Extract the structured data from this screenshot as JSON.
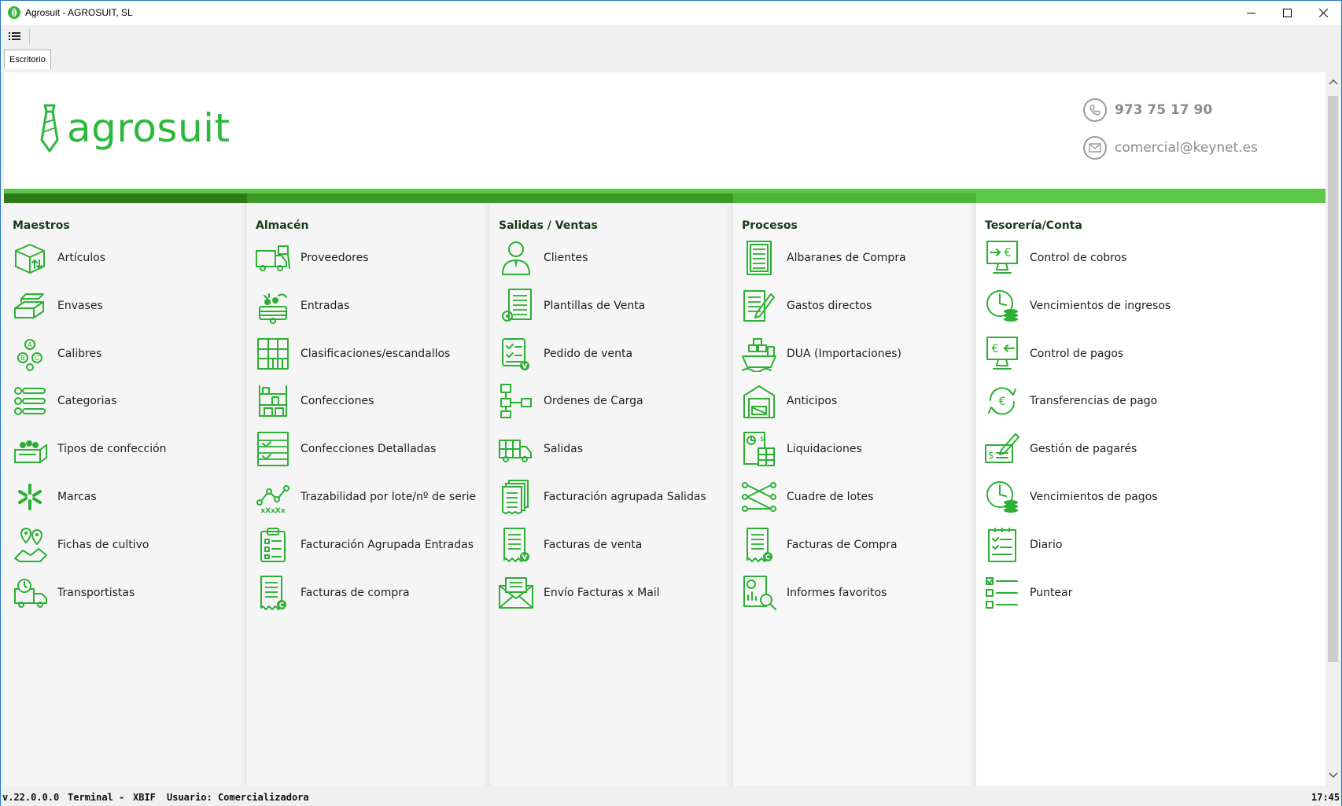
{
  "window": {
    "title": "Agrosuit - AGROSUIT, SL",
    "minimize_icon": "minimize-icon",
    "maximize_icon": "maximize-icon",
    "close_icon": "close-icon"
  },
  "toolbar": {
    "menu_icon": "list-menu-icon"
  },
  "tabs": [
    {
      "label": "Escritorio"
    }
  ],
  "header": {
    "logo_text": "agrosuit",
    "phone": "973 75 17 90",
    "email": "comercial@keynet.es"
  },
  "colors": {
    "brand_green": "#2db83d",
    "band_dark": "#2d7a18",
    "band_light": "#5cc84a",
    "icon_green": "#2bb034"
  },
  "columns": [
    {
      "title": "Maestros",
      "items": [
        {
          "label": "Artículos",
          "icon": "box-arrows-icon"
        },
        {
          "label": "Envases",
          "icon": "crates-icon"
        },
        {
          "label": "Calibres",
          "icon": "abc-circles-icon"
        },
        {
          "label": "Categorias",
          "icon": "numbered-list-icon"
        },
        {
          "label": "Tipos de confección",
          "icon": "produce-box-icon"
        },
        {
          "label": "Marcas",
          "icon": "asterisk-brand-icon"
        },
        {
          "label": "Fichas de cultivo",
          "icon": "map-pins-icon"
        },
        {
          "label": "Transportistas",
          "icon": "clock-truck-icon"
        }
      ]
    },
    {
      "title": "Almacén",
      "items": [
        {
          "label": "Proveedores",
          "icon": "delivery-truck-icon"
        },
        {
          "label": "Entradas",
          "icon": "produce-crate-icon"
        },
        {
          "label": "Clasificaciones/escandallos",
          "icon": "grid-icon"
        },
        {
          "label": "Confecciones",
          "icon": "shelves-icon"
        },
        {
          "label": "Confecciones Detalladas",
          "icon": "check-list-icon"
        },
        {
          "label": "Trazabilidad por lote/nº de serie",
          "icon": "trace-graph-icon",
          "sub": "xXxXx"
        },
        {
          "label": "Facturación Agrupada Entradas",
          "icon": "clipboard-icon"
        },
        {
          "label": "Facturas de compra",
          "icon": "invoice-c-icon",
          "badge": "C"
        }
      ]
    },
    {
      "title": "Salidas / Ventas",
      "items": [
        {
          "label": "Clientes",
          "icon": "client-person-icon"
        },
        {
          "label": "Plantillas de Venta",
          "icon": "document-gear-icon"
        },
        {
          "label": "Pedido de venta",
          "icon": "order-checklist-icon",
          "badge": "V"
        },
        {
          "label": "Ordenes de Carga",
          "icon": "flowchart-icon"
        },
        {
          "label": "Salidas",
          "icon": "truck-icon"
        },
        {
          "label": "Facturación agrupada Salidas",
          "icon": "stacked-documents-icon"
        },
        {
          "label": "Facturas de venta",
          "icon": "invoice-v-icon",
          "badge": "V"
        },
        {
          "label": "Envío Facturas x Mail",
          "icon": "envelope-icon"
        }
      ]
    },
    {
      "title": "Procesos",
      "items": [
        {
          "label": "Albaranes de Compra",
          "icon": "ledger-icon"
        },
        {
          "label": "Gastos directos",
          "icon": "document-pen-icon"
        },
        {
          "label": "DUA (Importaciones)",
          "icon": "cargo-ship-icon"
        },
        {
          "label": "Anticipos",
          "icon": "warehouse-money-icon"
        },
        {
          "label": "Liquidaciones",
          "icon": "calculator-document-icon"
        },
        {
          "label": "Cuadre de lotes",
          "icon": "lot-matching-icon"
        },
        {
          "label": "Facturas de Compra",
          "icon": "invoice-c-icon",
          "badge": "C"
        },
        {
          "label": "Informes favoritos",
          "icon": "report-magnifier-icon"
        }
      ]
    },
    {
      "title": "Tesorería/Conta",
      "items": [
        {
          "label": "Control de cobros",
          "icon": "monitor-euro-in-icon"
        },
        {
          "label": "Vencimientos de ingresos",
          "icon": "clock-coins-icon"
        },
        {
          "label": "Control de pagos",
          "icon": "monitor-euro-out-icon"
        },
        {
          "label": "Transferencias de pago",
          "icon": "euro-cycle-icon"
        },
        {
          "label": "Gestión de pagarés",
          "icon": "promissory-note-icon"
        },
        {
          "label": "Vencimientos de pagos",
          "icon": "clock-coins-icon"
        },
        {
          "label": "Diario",
          "icon": "journal-icon"
        },
        {
          "label": "Puntear",
          "icon": "checkbox-list-icon"
        }
      ]
    }
  ],
  "status": {
    "version": "v.22.0.0.0",
    "terminal_label": "Terminal",
    "separator": "-",
    "terminal": "XBIF",
    "user": "Usuario: Comercializadora",
    "time": "17:45"
  }
}
